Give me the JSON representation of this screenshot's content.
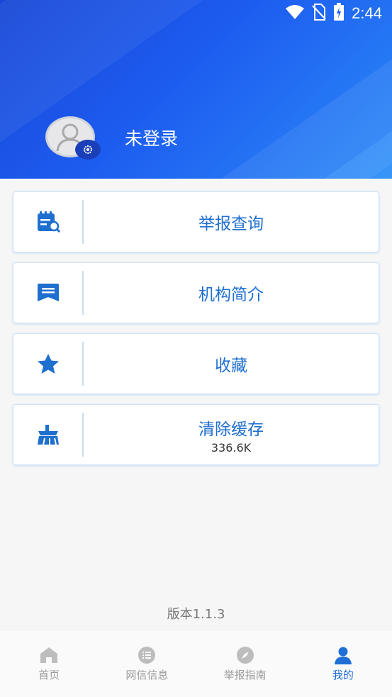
{
  "status_bar": {
    "time": "2:44"
  },
  "header": {
    "login_status": "未登录"
  },
  "menu": {
    "items": [
      {
        "label": "举报查询",
        "icon": "report-search-icon"
      },
      {
        "label": "机构简介",
        "icon": "message-icon"
      },
      {
        "label": "收藏",
        "icon": "star-icon"
      },
      {
        "label": "清除缓存",
        "sub": "336.6K",
        "icon": "broom-icon"
      }
    ]
  },
  "version": "版本1.1.3",
  "bottom_nav": {
    "items": [
      {
        "label": "首页",
        "icon": "home-icon"
      },
      {
        "label": "网信信息",
        "icon": "list-icon"
      },
      {
        "label": "举报指南",
        "icon": "compass-icon"
      },
      {
        "label": "我的",
        "icon": "person-icon",
        "active": true
      }
    ]
  },
  "colors": {
    "accent": "#1f6fd6",
    "header": "#1d5cf0",
    "card_text": "#1f6fcf"
  }
}
